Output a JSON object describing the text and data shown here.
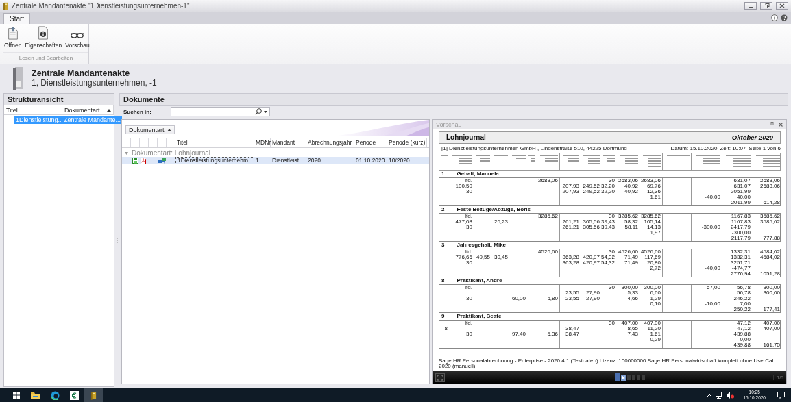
{
  "window": {
    "title": "Zentrale Mandantenakte \"1Dienstleistungsunternehmen-1\""
  },
  "ribbon": {
    "tabs": [
      {
        "label": "Start",
        "selected": true
      }
    ],
    "buttons": [
      {
        "label": "Öffnen",
        "kind": "open"
      },
      {
        "label": "Eigenschaften",
        "kind": "properties"
      },
      {
        "label": "Vorschau",
        "kind": "preview"
      }
    ],
    "group_label": "Lesen und Bearbeiten"
  },
  "header": {
    "title": "Zentrale Mandantenakte",
    "subtitle": "1, Dienstleistungsunternehmen, -1"
  },
  "structure": {
    "title": "Strukturansicht",
    "columns": [
      "Titel",
      "Dokumentart"
    ],
    "rows": [
      {
        "title": "1Dienstleistung...",
        "type": "Zentrale Mandante...",
        "selected": true
      }
    ]
  },
  "documents": {
    "title": "Dokumente",
    "search_label": "Suchen in:",
    "group_by": "Dokumentart",
    "columns": [
      "Titel",
      "MDNr",
      "Mandant",
      "Abrechnungsjahr",
      "Periode",
      "Periode (kurz)"
    ],
    "groups": [
      {
        "label": "Dokumentart: Lohnjournal",
        "expanded": true,
        "rows": [
          {
            "cells": [
              "1Dienstleistungsunternehm...",
              "1",
              "Dienstleist...",
              "2020",
              "01.10.2020",
              "10/2020"
            ],
            "selected": true
          }
        ]
      }
    ]
  },
  "preview": {
    "title": "Vorschau",
    "page_indicator": "1/6",
    "pages": [
      {
        "selected": true
      },
      {
        "selected": false
      },
      {
        "selected": false
      },
      {
        "selected": false
      },
      {
        "selected": false
      }
    ],
    "document": {
      "title": "Lohnjournal",
      "period": "Oktober 2020",
      "company": "[1] Dienstleistungsunternehmen GmbH , Lindenstraße 510, 44225 Dortmund",
      "date": "Datum: 15.10.2020",
      "time": "Zeit: 10:07",
      "page": "Seite 1 von 6",
      "employees": [
        {
          "number": "1",
          "name": "Gehalt, Manuela",
          "rows": [
            [
              null,
              "lfd.",
              null,
              null,
              null,
              null,
              "2683,06",
              null,
              null,
              "30",
              "2683,06",
              "2683,06",
              null,
              null,
              "631,07",
              "2683,06"
            ],
            [
              null,
              "100,50",
              null,
              null,
              null,
              null,
              null,
              "207,93",
              "249,52",
              "32,20",
              "40,92",
              "69,76",
              null,
              null,
              "631,07",
              "2683,06"
            ],
            [
              null,
              "30",
              null,
              null,
              null,
              null,
              null,
              "207,93",
              "249,52",
              "32,20",
              "40,92",
              "12,36",
              null,
              null,
              "2051,99",
              null
            ],
            [
              null,
              null,
              null,
              null,
              null,
              null,
              null,
              null,
              null,
              null,
              null,
              "1,61",
              null,
              "-40,00",
              "40,00",
              null
            ],
            [
              null,
              null,
              null,
              null,
              null,
              null,
              null,
              null,
              null,
              null,
              null,
              null,
              null,
              null,
              "2011,99",
              "614,28"
            ]
          ]
        },
        {
          "number": "2",
          "name": "Feste Bezüge/Abzüge, Boris",
          "rows": [
            [
              null,
              "lfd.",
              null,
              null,
              null,
              null,
              "3285,62",
              null,
              null,
              "30",
              "3285,62",
              "3285,62",
              null,
              null,
              "1167,83",
              "3585,62"
            ],
            [
              null,
              "477,08",
              null,
              "26,23",
              null,
              null,
              null,
              "261,21",
              "305,56",
              "39,43",
              "58,32",
              "105,14",
              null,
              null,
              "1167,83",
              "3585,62"
            ],
            [
              null,
              "30",
              null,
              null,
              null,
              null,
              null,
              "261,21",
              "305,56",
              "39,43",
              "58,11",
              "14,13",
              null,
              "-300,00",
              "2417,79",
              null
            ],
            [
              null,
              null,
              null,
              null,
              null,
              null,
              null,
              null,
              null,
              null,
              null,
              "1,97",
              null,
              null,
              "-300,00",
              null
            ],
            [
              null,
              null,
              null,
              null,
              null,
              null,
              null,
              null,
              null,
              null,
              null,
              null,
              null,
              null,
              "2117,79",
              "777,88"
            ]
          ]
        },
        {
          "number": "3",
          "name": "Jahresgehalt, Mike",
          "rows": [
            [
              null,
              "lfd.",
              null,
              null,
              null,
              null,
              "4526,60",
              null,
              null,
              "30",
              "4526,60",
              "4526,60",
              null,
              null,
              "1332,31",
              "4584,02"
            ],
            [
              null,
              "776,66",
              "49,55",
              "30,45",
              null,
              null,
              null,
              "363,28",
              "420,97",
              "54,32",
              "71,49",
              "117,69",
              null,
              null,
              "1332,31",
              "4584,02"
            ],
            [
              null,
              "30",
              null,
              null,
              null,
              null,
              null,
              "363,28",
              "420,97",
              "54,32",
              "71,49",
              "20,80",
              null,
              null,
              "3251,71",
              null
            ],
            [
              null,
              null,
              null,
              null,
              null,
              null,
              null,
              null,
              null,
              null,
              null,
              "2,72",
              null,
              "-40,00",
              "-474,77",
              null
            ],
            [
              null,
              null,
              null,
              null,
              null,
              null,
              null,
              null,
              null,
              null,
              null,
              null,
              null,
              null,
              "2776,94",
              "1051,28"
            ]
          ]
        },
        {
          "number": "8",
          "name": "Praktikant, Andre",
          "rows": [
            [
              null,
              "lfd.",
              null,
              null,
              null,
              null,
              null,
              null,
              null,
              "30",
              "300,00",
              "300,00",
              null,
              "57,00",
              "56,78",
              "300,00"
            ],
            [
              null,
              null,
              null,
              null,
              null,
              null,
              null,
              "23,55",
              "27,90",
              null,
              "5,33",
              "6,60",
              null,
              null,
              "56,78",
              "300,00"
            ],
            [
              null,
              "30",
              null,
              null,
              "60,00",
              null,
              "5,80",
              "23,55",
              "27,90",
              null,
              "4,66",
              "1,29",
              null,
              null,
              "246,22",
              null
            ],
            [
              null,
              null,
              null,
              null,
              null,
              null,
              null,
              null,
              null,
              null,
              null,
              "0,10",
              null,
              "-10,00",
              "7,00",
              null
            ],
            [
              null,
              null,
              null,
              null,
              null,
              null,
              null,
              null,
              null,
              null,
              null,
              null,
              null,
              null,
              "250,22",
              "177,41"
            ]
          ]
        },
        {
          "number": "9",
          "name": "Praktikant, Beate",
          "rows": [
            [
              null,
              "lfd.",
              null,
              null,
              null,
              null,
              null,
              null,
              null,
              "30",
              "407,00",
              "407,00",
              null,
              null,
              "47,12",
              "407,00"
            ],
            [
              "8",
              null,
              null,
              null,
              null,
              null,
              null,
              "38,47",
              null,
              null,
              "8,65",
              "11,20",
              null,
              null,
              "47,12",
              "407,00"
            ],
            [
              null,
              "30",
              null,
              null,
              "97,40",
              null,
              "5,36",
              "38,47",
              null,
              null,
              "7,43",
              "1,61",
              null,
              null,
              "439,88",
              null
            ],
            [
              null,
              null,
              null,
              null,
              null,
              null,
              null,
              null,
              null,
              null,
              null,
              "0,29",
              null,
              null,
              "0,00",
              null
            ],
            [
              null,
              null,
              null,
              null,
              null,
              null,
              null,
              null,
              null,
              null,
              null,
              null,
              null,
              null,
              "439,88",
              "161,75"
            ]
          ]
        }
      ],
      "footer": "Sage HR Personalabrechnung - Enterprise - 2020.4.1 (Testdaten) Lizenz: 100000000 Sage HR Personalwirtschaft komplett ohne UserCal 2020 (manuell)"
    }
  },
  "taskbar": {
    "time": "10:25",
    "date": "15.10.2020"
  }
}
